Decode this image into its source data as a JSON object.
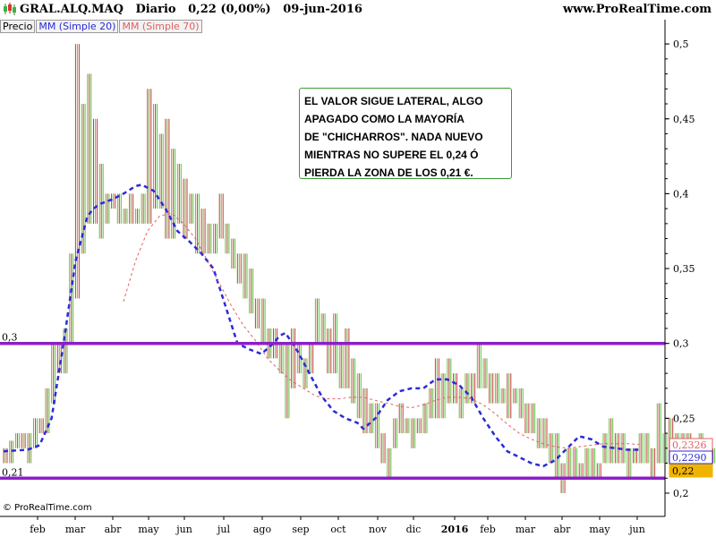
{
  "header": {
    "symbol": "GRAL.ALQ.MAQ",
    "timeframe": "Diario",
    "last_price": "0,22 (0,00%)",
    "date": "09-jun-2016",
    "brand": "www.ProRealTime.com",
    "icon": "candlestick-chart-icon"
  },
  "legend": {
    "price_label": "Precio",
    "ma20_label": "MM (Simple 20)",
    "ma70_label": "MM (Simple 70)"
  },
  "annotation": {
    "lines": [
      "EL VALOR SIGUE LATERAL, ALGO",
      "APAGADO COMO LA MAYORÍA",
      "DE \"CHICHARROS\". NADA NUEVO",
      "MIENTRAS NO SUPERE EL 0,24 Ó",
      "PIERDA LA ZONA DE LOS 0,21 €."
    ]
  },
  "footer": {
    "copyright": "© ProRealTime.com"
  },
  "chart_data": {
    "type": "line",
    "title": "",
    "x_tick_labels": [
      "feb",
      "mar",
      "abr",
      "may",
      "jun",
      "jul",
      "ago",
      "sep",
      "oct",
      "nov",
      "dic",
      "2016",
      "feb",
      "mar",
      "abr",
      "may",
      "jun"
    ],
    "y_tick_labels": [
      "0,5",
      "0,45",
      "0,4",
      "0,35",
      "0,3",
      "0,25",
      "0,2"
    ],
    "y_ticks": [
      0.5,
      0.45,
      0.4,
      0.35,
      0.3,
      0.25,
      0.2
    ],
    "ylim": [
      0.195,
      0.51
    ],
    "grid": false,
    "horizontal_lines": [
      {
        "label": "0,3",
        "value": 0.3,
        "color": "#8b1fc8"
      },
      {
        "label": "0,21",
        "value": 0.21,
        "color": "#8b1fc8"
      }
    ],
    "value_badges": [
      {
        "label": "0,2326",
        "value": 0.2326,
        "color": "#e26060"
      },
      {
        "label": "0,2290",
        "value": 0.229,
        "color": "#2b2bd8"
      },
      {
        "label": "0,22",
        "value": 0.22,
        "color": "#f0b400"
      }
    ],
    "price_ranges": [
      [
        0.22,
        0.23
      ],
      [
        0.22,
        0.235
      ],
      [
        0.23,
        0.24
      ],
      [
        0.23,
        0.24
      ],
      [
        0.22,
        0.24
      ],
      [
        0.23,
        0.25
      ],
      [
        0.24,
        0.25
      ],
      [
        0.24,
        0.27
      ],
      [
        0.26,
        0.3
      ],
      [
        0.28,
        0.3
      ],
      [
        0.28,
        0.31
      ],
      [
        0.3,
        0.36
      ],
      [
        0.33,
        0.5
      ],
      [
        0.36,
        0.46
      ],
      [
        0.38,
        0.48
      ],
      [
        0.38,
        0.45
      ],
      [
        0.37,
        0.42
      ],
      [
        0.38,
        0.4
      ],
      [
        0.39,
        0.4
      ],
      [
        0.38,
        0.4
      ],
      [
        0.38,
        0.39
      ],
      [
        0.38,
        0.4
      ],
      [
        0.38,
        0.39
      ],
      [
        0.38,
        0.4
      ],
      [
        0.38,
        0.47
      ],
      [
        0.39,
        0.46
      ],
      [
        0.39,
        0.44
      ],
      [
        0.37,
        0.45
      ],
      [
        0.37,
        0.43
      ],
      [
        0.38,
        0.42
      ],
      [
        0.37,
        0.41
      ],
      [
        0.38,
        0.4
      ],
      [
        0.36,
        0.4
      ],
      [
        0.36,
        0.39
      ],
      [
        0.36,
        0.38
      ],
      [
        0.36,
        0.38
      ],
      [
        0.37,
        0.4
      ],
      [
        0.36,
        0.38
      ],
      [
        0.35,
        0.37
      ],
      [
        0.34,
        0.36
      ],
      [
        0.33,
        0.36
      ],
      [
        0.32,
        0.35
      ],
      [
        0.31,
        0.33
      ],
      [
        0.3,
        0.33
      ],
      [
        0.29,
        0.31
      ],
      [
        0.29,
        0.31
      ],
      [
        0.28,
        0.3
      ],
      [
        0.25,
        0.3
      ],
      [
        0.27,
        0.31
      ],
      [
        0.28,
        0.3
      ],
      [
        0.27,
        0.29
      ],
      [
        0.28,
        0.3
      ],
      [
        0.3,
        0.33
      ],
      [
        0.3,
        0.32
      ],
      [
        0.28,
        0.31
      ],
      [
        0.28,
        0.32
      ],
      [
        0.27,
        0.3
      ],
      [
        0.27,
        0.31
      ],
      [
        0.26,
        0.29
      ],
      [
        0.25,
        0.28
      ],
      [
        0.24,
        0.27
      ],
      [
        0.24,
        0.26
      ],
      [
        0.23,
        0.26
      ],
      [
        0.22,
        0.24
      ],
      [
        0.21,
        0.23
      ],
      [
        0.23,
        0.25
      ],
      [
        0.24,
        0.26
      ],
      [
        0.24,
        0.25
      ],
      [
        0.23,
        0.25
      ],
      [
        0.24,
        0.25
      ],
      [
        0.24,
        0.26
      ],
      [
        0.25,
        0.27
      ],
      [
        0.25,
        0.29
      ],
      [
        0.25,
        0.28
      ],
      [
        0.26,
        0.29
      ],
      [
        0.26,
        0.28
      ],
      [
        0.25,
        0.27
      ],
      [
        0.26,
        0.28
      ],
      [
        0.26,
        0.28
      ],
      [
        0.27,
        0.3
      ],
      [
        0.27,
        0.29
      ],
      [
        0.26,
        0.28
      ],
      [
        0.26,
        0.28
      ],
      [
        0.26,
        0.27
      ],
      [
        0.25,
        0.28
      ],
      [
        0.26,
        0.27
      ],
      [
        0.25,
        0.27
      ],
      [
        0.24,
        0.26
      ],
      [
        0.24,
        0.26
      ],
      [
        0.23,
        0.25
      ],
      [
        0.23,
        0.25
      ],
      [
        0.22,
        0.24
      ],
      [
        0.21,
        0.24
      ],
      [
        0.2,
        0.22
      ],
      [
        0.21,
        0.23
      ],
      [
        0.21,
        0.23
      ],
      [
        0.21,
        0.22
      ],
      [
        0.21,
        0.23
      ],
      [
        0.21,
        0.23
      ],
      [
        0.21,
        0.22
      ],
      [
        0.22,
        0.24
      ],
      [
        0.22,
        0.25
      ],
      [
        0.22,
        0.24
      ],
      [
        0.22,
        0.24
      ],
      [
        0.21,
        0.23
      ],
      [
        0.22,
        0.23
      ],
      [
        0.22,
        0.24
      ],
      [
        0.22,
        0.24
      ],
      [
        0.21,
        0.23
      ],
      [
        0.22,
        0.26
      ],
      [
        0.22,
        0.24
      ],
      [
        0.22,
        0.25
      ],
      [
        0.22,
        0.24
      ],
      [
        0.23,
        0.24
      ],
      [
        0.22,
        0.24
      ],
      [
        0.22,
        0.23
      ],
      [
        0.22,
        0.24
      ],
      [
        0.22,
        0.23
      ],
      [
        0.22,
        0.23
      ],
      [
        0.22,
        0.24
      ],
      [
        0.22,
        0.23
      ],
      [
        0.22,
        0.24
      ],
      [
        0.21,
        0.23
      ],
      [
        0.22,
        0.23
      ]
    ],
    "series": [
      {
        "name": "MM (Simple 20)",
        "color": "#2b2bd8",
        "style": "dashed",
        "points": [
          [
            0,
            0.228
          ],
          [
            4,
            0.229
          ],
          [
            6,
            0.232
          ],
          [
            8,
            0.25
          ],
          [
            10,
            0.3
          ],
          [
            12,
            0.355
          ],
          [
            14,
            0.385
          ],
          [
            15,
            0.39
          ],
          [
            16,
            0.393
          ],
          [
            18,
            0.396
          ],
          [
            20,
            0.4
          ],
          [
            22,
            0.405
          ],
          [
            23,
            0.406
          ],
          [
            25,
            0.402
          ],
          [
            27,
            0.39
          ],
          [
            29,
            0.375
          ],
          [
            31,
            0.368
          ],
          [
            33,
            0.36
          ],
          [
            35,
            0.35
          ],
          [
            37,
            0.325
          ],
          [
            39,
            0.3
          ],
          [
            41,
            0.296
          ],
          [
            43,
            0.293
          ],
          [
            45,
            0.3
          ],
          [
            46,
            0.305
          ],
          [
            47,
            0.307
          ],
          [
            49,
            0.295
          ],
          [
            51,
            0.28
          ],
          [
            53,
            0.265
          ],
          [
            55,
            0.255
          ],
          [
            57,
            0.25
          ],
          [
            59,
            0.247
          ],
          [
            60,
            0.243
          ],
          [
            62,
            0.25
          ],
          [
            64,
            0.262
          ],
          [
            66,
            0.268
          ],
          [
            68,
            0.27
          ],
          [
            70,
            0.27
          ],
          [
            71,
            0.273
          ],
          [
            72,
            0.276
          ],
          [
            74,
            0.276
          ],
          [
            76,
            0.272
          ],
          [
            78,
            0.264
          ],
          [
            80,
            0.25
          ],
          [
            82,
            0.238
          ],
          [
            84,
            0.228
          ],
          [
            86,
            0.224
          ],
          [
            88,
            0.22
          ],
          [
            90,
            0.218
          ],
          [
            92,
            0.222
          ],
          [
            94,
            0.23
          ],
          [
            96,
            0.238
          ],
          [
            98,
            0.236
          ],
          [
            100,
            0.231
          ],
          [
            102,
            0.23
          ],
          [
            104,
            0.229
          ],
          [
            106,
            0.229
          ]
        ]
      },
      {
        "name": "MM (Simple 70)",
        "color": "#e26060",
        "style": "dotted",
        "points": [
          [
            20,
            0.328
          ],
          [
            22,
            0.355
          ],
          [
            24,
            0.375
          ],
          [
            26,
            0.385
          ],
          [
            28,
            0.387
          ],
          [
            30,
            0.38
          ],
          [
            32,
            0.37
          ],
          [
            34,
            0.355
          ],
          [
            36,
            0.34
          ],
          [
            38,
            0.325
          ],
          [
            40,
            0.312
          ],
          [
            42,
            0.302
          ],
          [
            44,
            0.29
          ],
          [
            46,
            0.282
          ],
          [
            48,
            0.275
          ],
          [
            50,
            0.27
          ],
          [
            52,
            0.265
          ],
          [
            54,
            0.263
          ],
          [
            56,
            0.263
          ],
          [
            58,
            0.264
          ],
          [
            60,
            0.264
          ],
          [
            62,
            0.262
          ],
          [
            64,
            0.26
          ],
          [
            66,
            0.258
          ],
          [
            68,
            0.257
          ],
          [
            70,
            0.259
          ],
          [
            72,
            0.262
          ],
          [
            74,
            0.264
          ],
          [
            76,
            0.264
          ],
          [
            78,
            0.263
          ],
          [
            80,
            0.259
          ],
          [
            82,
            0.253
          ],
          [
            84,
            0.246
          ],
          [
            86,
            0.24
          ],
          [
            88,
            0.236
          ],
          [
            90,
            0.233
          ],
          [
            92,
            0.231
          ],
          [
            94,
            0.23
          ],
          [
            96,
            0.231
          ],
          [
            98,
            0.232
          ],
          [
            100,
            0.233
          ],
          [
            102,
            0.233
          ],
          [
            104,
            0.233
          ],
          [
            106,
            0.2326
          ]
        ]
      }
    ]
  }
}
